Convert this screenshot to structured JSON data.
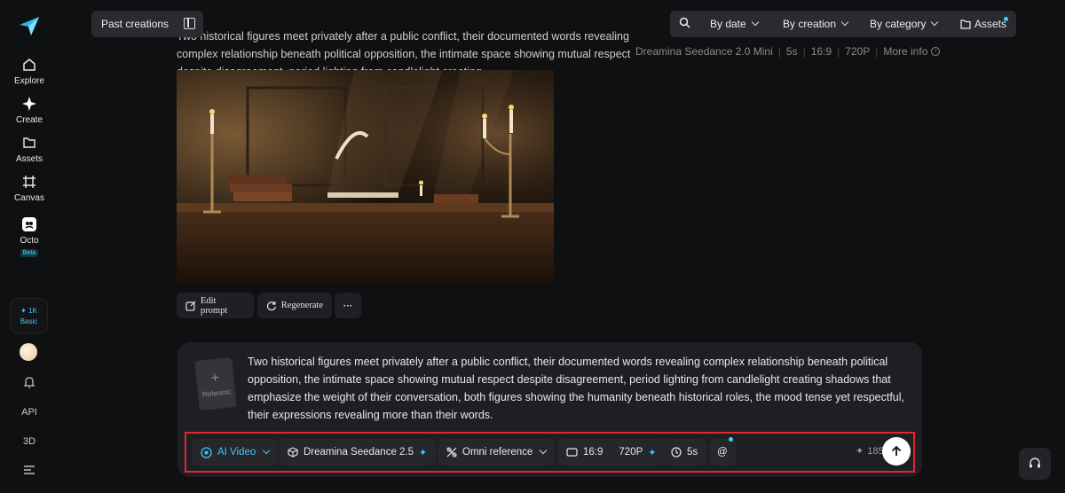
{
  "sidebar": {
    "items": [
      {
        "label": "Explore",
        "icon": "home-icon"
      },
      {
        "label": "Create",
        "icon": "sparkle-icon"
      },
      {
        "label": "Assets",
        "icon": "folder-icon"
      },
      {
        "label": "Canvas",
        "icon": "canvas-icon"
      },
      {
        "label": "Octo",
        "icon": "octo-icon",
        "badge": "Beta"
      }
    ],
    "credits": {
      "amount": "1K",
      "plan": "Basic"
    },
    "bottom": {
      "api": "API",
      "three_d": "3D"
    }
  },
  "topbar": {
    "past_creations": "Past creations",
    "filters": {
      "by_date": "By date",
      "by_creation": "By creation",
      "by_category": "By category",
      "assets": "Assets"
    }
  },
  "history": {
    "prompt": "Two historical figures meet privately after a public conflict, their documented words revealing complex relationship beneath political opposition, the intimate space showing mutual respect despite disagreement, period lighting from candlelight creating",
    "meta": {
      "model": "Dreamina Seedance 2.0 Mini",
      "duration": "5s",
      "ratio": "16:9",
      "resolution": "720P",
      "more_info": "More info"
    },
    "actions": {
      "edit_prompt": "Edit prompt",
      "regenerate": "Regenerate",
      "more": "···"
    }
  },
  "composer": {
    "reference_label": "Referenc",
    "prompt": "Two historical figures meet privately after a public conflict, their documented words revealing complex relationship beneath political opposition, the intimate space showing mutual respect despite disagreement, period lighting from candlelight creating shadows that emphasize the weight of their conversation, both figures showing the humanity beneath historical roles, the mood tense yet respectful, their expressions revealing more than their words.",
    "toolbar": {
      "mode": "AI Video",
      "model": "Dreamina Seedance 2.5",
      "reference": "Omni reference",
      "ratio": "16:9",
      "resolution": "720P",
      "duration": "5s",
      "mention": "@",
      "cost": "185"
    }
  },
  "colors": {
    "accent": "#3cc8ff",
    "highlight_border": "#e12631",
    "background": "#0f1012"
  }
}
